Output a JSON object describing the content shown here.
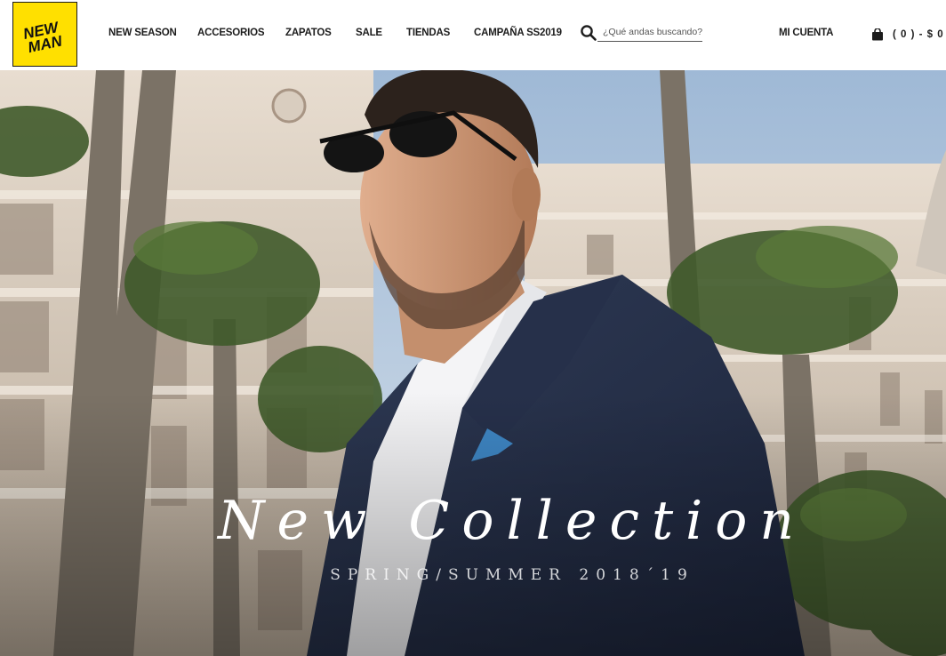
{
  "brand": {
    "logo_line1": "NEW",
    "logo_line2": "MAN",
    "logo_color": "#ffe000"
  },
  "nav": {
    "items": [
      {
        "label": "NEW SEASON"
      },
      {
        "label": "ACCESORIOS"
      },
      {
        "label": "ZAPATOS"
      },
      {
        "label": "SALE"
      },
      {
        "label": "TIENDAS"
      },
      {
        "label": "CAMPAÑA SS2019"
      }
    ]
  },
  "search": {
    "placeholder": "¿Qué andas buscando?",
    "value": "",
    "icon": "search-icon"
  },
  "account": {
    "label": "MI CUENTA"
  },
  "cart": {
    "label": "( 0 ) - $ 0",
    "icon": "shopping-bag-icon"
  },
  "hero": {
    "title": "New Collection",
    "subtitle": "SPRING/SUMMER 2018´19"
  }
}
